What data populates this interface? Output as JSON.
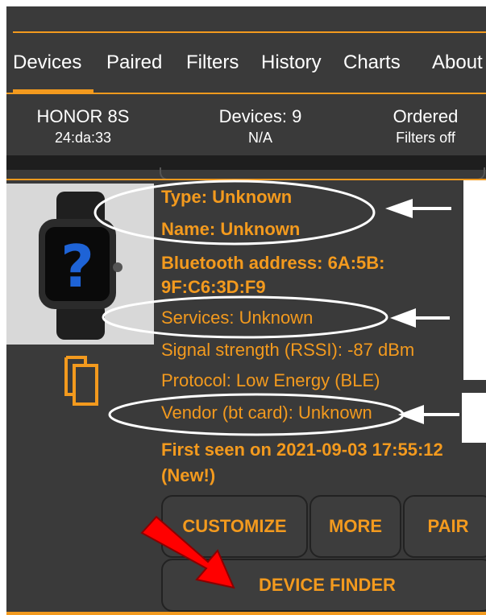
{
  "tabs": [
    "Devices",
    "Paired",
    "Filters",
    "History",
    "Charts",
    "About"
  ],
  "info": {
    "device_name": "HONOR 8S",
    "device_address": "24:da:33",
    "devices_count": "Devices: 9",
    "devices_sub": "N/A",
    "sort": "Ordered",
    "filters": "Filters off"
  },
  "device": {
    "type": "Type: Unknown",
    "name": "Name: Unknown",
    "bt_address_1": "Bluetooth address: 6A:5B:",
    "bt_address_2": "9F:C6:3D:F9",
    "services": "Services: Unknown",
    "rssi": "Signal strength (RSSI): -87 dBm",
    "protocol": "Protocol: Low Energy (BLE)",
    "vendor": "Vendor (bt card): Unknown",
    "first_seen_1": "First seen on 2021-09-03 17:55:12",
    "first_seen_2": "(New!)",
    "image_icon": "smartwatch-question-icon"
  },
  "buttons": {
    "customize": "CUSTOMIZE",
    "more": "MORE",
    "pair": "PAIR",
    "device_finder": "DEVICE FINDER"
  },
  "colors": {
    "accent": "#f39a1e",
    "background": "#3a3a3a",
    "highlight_arrow": "#ff0000"
  }
}
